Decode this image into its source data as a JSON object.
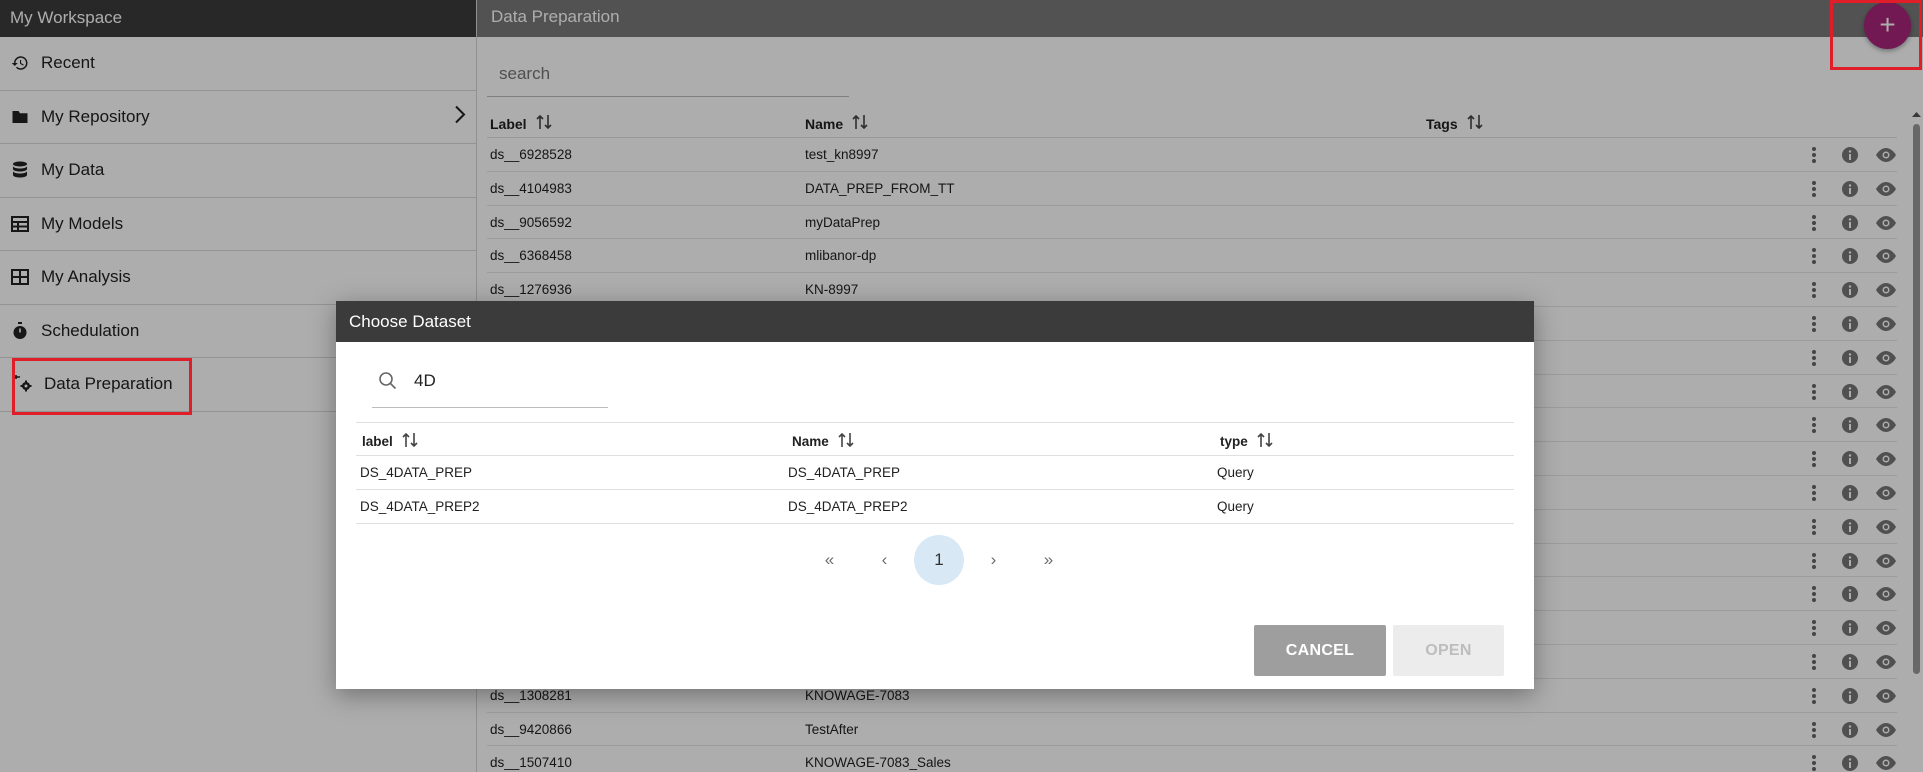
{
  "sidebar": {
    "title": "My Workspace",
    "items": [
      {
        "label": "Recent",
        "icon": "history-icon"
      },
      {
        "label": "My Repository",
        "icon": "folder-icon"
      },
      {
        "label": "My Data",
        "icon": "database-icon"
      },
      {
        "label": "My Models",
        "icon": "table-icon"
      },
      {
        "label": "My Analysis",
        "icon": "grid-icon"
      },
      {
        "label": "Schedulation",
        "icon": "stopwatch-icon"
      },
      {
        "label": "Data Preparation",
        "icon": "data-prep-gear-icon"
      }
    ]
  },
  "main": {
    "title": "Data Preparation",
    "search_placeholder": "search",
    "columns": [
      "Label",
      "Name",
      "Tags"
    ],
    "rows": [
      {
        "label": "ds__6928528",
        "name": "test_kn8997"
      },
      {
        "label": "ds__4104983",
        "name": "DATA_PREP_FROM_TT"
      },
      {
        "label": "ds__9056592",
        "name": "myDataPrep"
      },
      {
        "label": "ds__6368458",
        "name": "mlibanor-dp"
      },
      {
        "label": "ds__1276936",
        "name": "KN-8997"
      },
      {
        "label": "",
        "name": ""
      },
      {
        "label": "",
        "name": ""
      },
      {
        "label": "",
        "name": ""
      },
      {
        "label": "",
        "name": ""
      },
      {
        "label": "",
        "name": ""
      },
      {
        "label": "",
        "name": ""
      },
      {
        "label": "",
        "name": ""
      },
      {
        "label": "",
        "name": ""
      },
      {
        "label": "",
        "name": ""
      },
      {
        "label": "",
        "name": ""
      },
      {
        "label": "",
        "name": ""
      },
      {
        "label": "ds__1308281",
        "name": "KNOWAGE-7083"
      },
      {
        "label": "ds__9420866",
        "name": "TestAfter"
      },
      {
        "label": "ds__1507410",
        "name": "KNOWAGE-7083_Sales"
      }
    ],
    "fab_label": "+"
  },
  "dialog": {
    "title": "Choose Dataset",
    "search_value": "4D",
    "columns": [
      "label",
      "Name",
      "type"
    ],
    "rows": [
      {
        "label": "DS_4DATA_PREP",
        "name": "DS_4DATA_PREP",
        "type": "Query"
      },
      {
        "label": "DS_4DATA_PREP2",
        "name": "DS_4DATA_PREP2",
        "type": "Query"
      }
    ],
    "pager": {
      "first": "«",
      "prev": "‹",
      "page": "1",
      "next": "›",
      "last": "»"
    },
    "cancel_label": "CANCEL",
    "open_label": "OPEN"
  },
  "colors": {
    "accent": "#a8247a",
    "highlight": "#e01e2a",
    "header_dark": "#3b3b3b"
  }
}
